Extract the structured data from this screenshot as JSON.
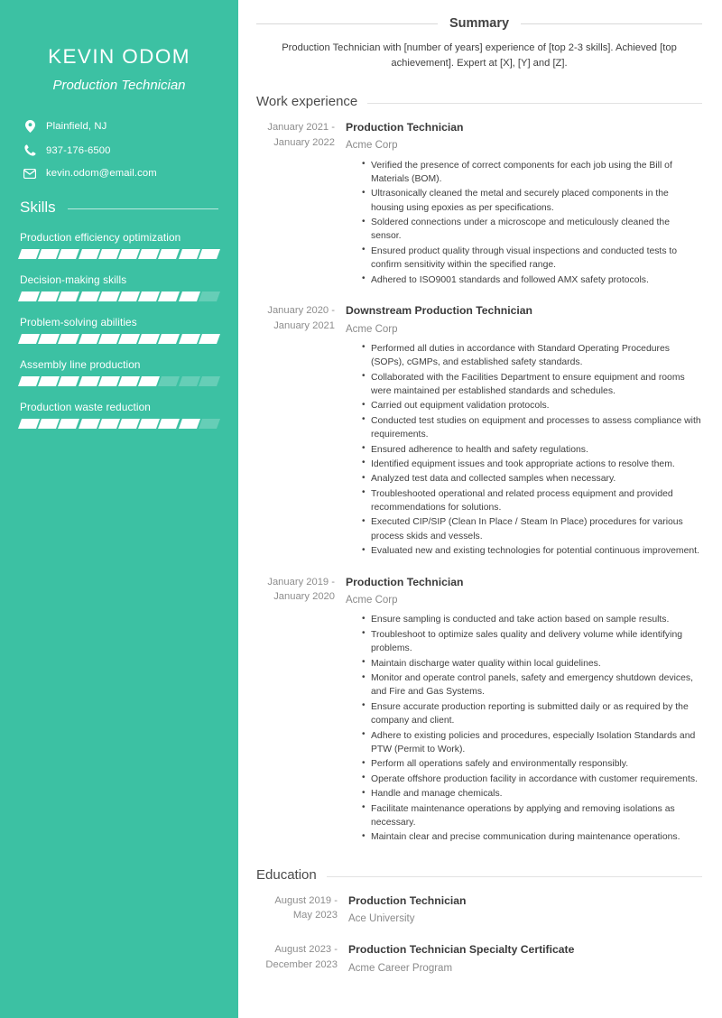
{
  "theme": {
    "sidebar_bg": "#3cc1a3",
    "sidebar_text": "#ffffff",
    "body_text": "#3f3f3f",
    "muted_text": "#8a8a8a"
  },
  "sidebar": {
    "name": "KEVIN ODOM",
    "title": "Production Technician",
    "contacts": [
      {
        "icon": "location-pin-icon",
        "value": "Plainfield, NJ"
      },
      {
        "icon": "phone-icon",
        "value": "937-176-6500"
      },
      {
        "icon": "envelope-icon",
        "value": "kevin.odom@email.com"
      }
    ],
    "skills_heading": "Skills",
    "skills_max": 10,
    "skills": [
      {
        "label": "Production efficiency optimization",
        "rating": 10
      },
      {
        "label": "Decision-making skills",
        "rating": 9
      },
      {
        "label": "Problem-solving abilities",
        "rating": 10
      },
      {
        "label": "Assembly line production",
        "rating": 7
      },
      {
        "label": "Production waste reduction",
        "rating": 9
      }
    ]
  },
  "main": {
    "summary": {
      "heading": "Summary",
      "text": "Production Technician with [number of years] experience of [top 2-3 skills]. Achieved [top achievement]. Expert at [X], [Y] and [Z]."
    },
    "work_experience": {
      "heading": "Work experience",
      "entries": [
        {
          "dates": "January 2021 - January 2022",
          "title": "Production Technician",
          "org": "Acme Corp",
          "bullets": [
            "Verified the presence of correct components for each job using the Bill of Materials (BOM).",
            "Ultrasonically cleaned the metal and securely placed components in the housing using epoxies as per specifications.",
            "Soldered connections under a microscope and meticulously cleaned the sensor.",
            "Ensured product quality through visual inspections and conducted tests to confirm sensitivity within the specified range.",
            "Adhered to ISO9001 standards and followed AMX safety protocols."
          ]
        },
        {
          "dates": "January 2020 - January 2021",
          "title": "Downstream Production Technician",
          "org": "Acme Corp",
          "bullets": [
            "Performed all duties in accordance with Standard Operating Procedures (SOPs), cGMPs, and established safety standards.",
            "Collaborated with the Facilities Department to ensure equipment and rooms were maintained per established standards and schedules.",
            "Carried out equipment validation protocols.",
            "Conducted test studies on equipment and processes to assess compliance with requirements.",
            "Ensured adherence to health and safety regulations.",
            "Identified equipment issues and took appropriate actions to resolve them.",
            "Analyzed test data and collected samples when necessary.",
            "Troubleshooted operational and related process equipment and provided recommendations for solutions.",
            "Executed CIP/SIP (Clean In Place / Steam In Place) procedures for various process skids and vessels.",
            "Evaluated new and existing technologies for potential continuous improvement."
          ]
        },
        {
          "dates": "January 2019 - January 2020",
          "title": "Production Technician",
          "org": "Acme Corp",
          "bullets": [
            "Ensure sampling is conducted and take action based on sample results.",
            "Troubleshoot to optimize sales quality and delivery volume while identifying problems.",
            "Maintain discharge water quality within local guidelines.",
            "Monitor and operate control panels, safety and emergency shutdown devices, and Fire and Gas Systems.",
            "Ensure accurate production reporting is submitted daily or as required by the company and client.",
            "Adhere to existing policies and procedures, especially Isolation Standards and PTW (Permit to Work).",
            "Perform all operations safely and environmentally responsibly.",
            "Operate offshore production facility in accordance with customer requirements.",
            "Handle and manage chemicals.",
            "Facilitate maintenance operations by applying and removing isolations as necessary.",
            "Maintain clear and precise communication during maintenance operations."
          ]
        }
      ]
    },
    "education": {
      "heading": "Education",
      "entries": [
        {
          "dates": "August 2019 - May 2023",
          "title": "Production Technician",
          "org": "Ace University"
        },
        {
          "dates": "August 2023 - December 2023",
          "title": "Production Technician Specialty Certificate",
          "org": "Acme Career Program"
        }
      ]
    }
  }
}
